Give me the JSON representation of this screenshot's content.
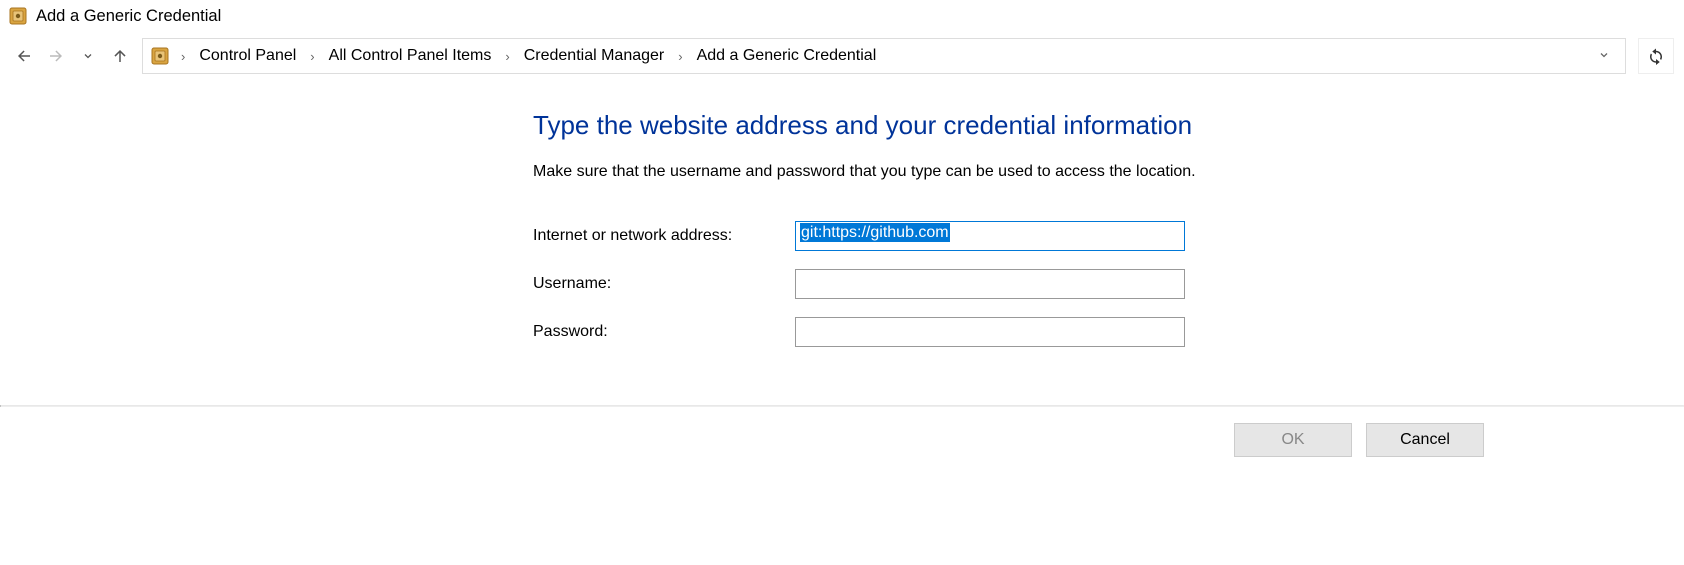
{
  "window": {
    "title": "Add a Generic Credential"
  },
  "breadcrumbs": {
    "items": [
      "Control Panel",
      "All Control Panel Items",
      "Credential Manager",
      "Add a Generic Credential"
    ]
  },
  "main": {
    "heading": "Type the website address and your credential information",
    "subtext": "Make sure that the username and password that you type can be used to access the location.",
    "fields": {
      "address_label": "Internet or network address:",
      "address_value": "git:https://github.com",
      "username_label": "Username:",
      "username_value": "",
      "password_label": "Password:",
      "password_value": ""
    }
  },
  "footer": {
    "ok_label": "OK",
    "cancel_label": "Cancel"
  },
  "icons": {
    "safe": "safe-icon",
    "back": "←",
    "forward": "→",
    "recent_chev": "⌄",
    "up": "↑",
    "sep": "›",
    "addr_chev": "⌄",
    "refresh": "↻"
  }
}
